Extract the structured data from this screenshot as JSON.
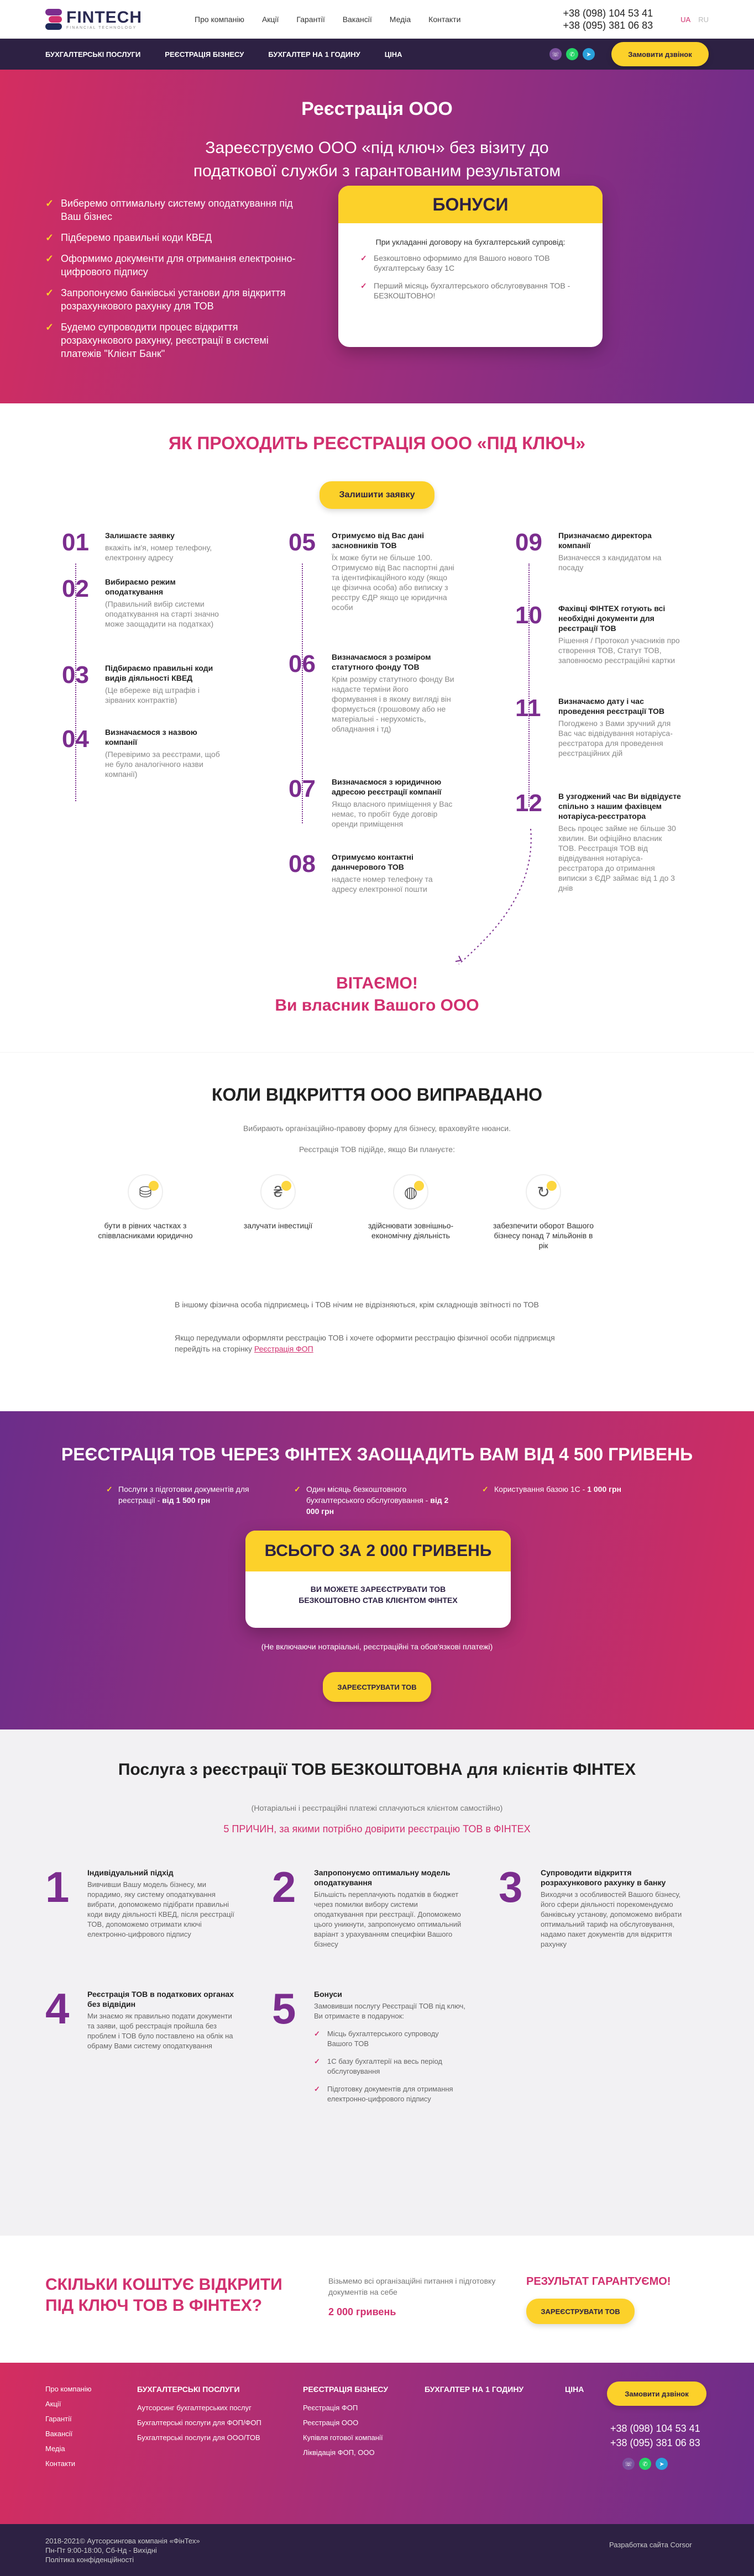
{
  "header": {
    "logo_name": "FINTECH",
    "logo_sub": "FINANCIAL TECHNOLOGY",
    "nav": [
      "Про компанію",
      "Акції",
      "Гарантії",
      "Вакансії",
      "Медіа",
      "Контакти"
    ],
    "phones": [
      "+38 (098) 104 53 41",
      "+38 (095) 381 06 83"
    ],
    "langs": [
      "UA",
      "RU"
    ]
  },
  "servicenav": {
    "items": [
      "Бухгалтерські послуги",
      "Реєстрація бізнесу",
      "Бухгалтер на 1 годину",
      "Ціна"
    ],
    "order_button": "Замовити дзвінок"
  },
  "hero": {
    "title": "Реєстрація ООО",
    "subtitle": "Зареєструємо ООО «під ключ» без візиту до податкової служби з гарантованим результатом",
    "checks": [
      "Виберемо оптимальну систему оподаткування під Ваш бізнес",
      "Підберемо правильні коди КВЕД",
      "Оформимо документи для отримання електронно-цифрового підпису",
      "Запропонуємо банківські установи для відкриття розрахункового рахунку для ТОВ",
      "Будемо супроводити процес відкриття розрахункового рахунку, реєстрації в системі платежів \"Клієнт Банк\""
    ],
    "bonus_title": "БОНУСИ",
    "bonus_intro": "При укладанні договору на бухгалтерський супровід:",
    "bonus_items": [
      "Безкоштовно оформимо для Вашого нового ТОВ бухгалтерську базу 1С",
      "Перший місяць бухгалтерського обслуговування ТОВ - БЕЗКОШТОВНО!"
    ]
  },
  "steps": {
    "title": "ЯК ПРОХОДИТЬ РЕЄСТРАЦІЯ ООО «ПІД КЛЮЧ»",
    "button": "Залишити заявку",
    "items": [
      {
        "num": "01",
        "title": "Залишаєте заявку",
        "text": "вкажіть ім'я, номер телефону, електронну адресу"
      },
      {
        "num": "02",
        "title": "Вибираємо режим оподаткування",
        "text": "(Правильний вибір системи оподаткування на старті значно може заощадити на податках)"
      },
      {
        "num": "03",
        "title": "Підбираємо правильні коди видів діяльності КВЕД",
        "text": "(Це вбереже від штрафів і зірваних контрактів)"
      },
      {
        "num": "04",
        "title": "Визначаємося з назвою компанії",
        "text": "(Перевіримо за реєстрами, щоб не було аналогічного назви компанії)"
      },
      {
        "num": "05",
        "title": "Отримуємо від Вас дані засновників ТОВ",
        "text": "Їх може бути не більше 100. Отримуємо від Вас паспортні дані та ідентифікаційного коду (якщо це фізична особа) або виписку з реєстру ЄДР якщо це юридична особи"
      },
      {
        "num": "06",
        "title": "Визначаємося з розміром статутного фонду ТОВ",
        "text": "Крім розміру статутного фонду Ви надаєте терміни його формування і в якому вигляді він формується (грошовому або не матеріальні - нерухомість, обладнання і тд)"
      },
      {
        "num": "07",
        "title": "Визначаємося з юридичною адресою реєстрації компанії",
        "text": "Якщо власного приміщення у Вас немає, то пробіт буде договір оренди приміщення"
      },
      {
        "num": "08",
        "title": "Отримуємо контактні даннчерового ТОВ",
        "text": "надаєте номер телефону та адресу електронної пошти"
      },
      {
        "num": "09",
        "title": "Призначаємо директора компанії",
        "text": "Визначеєся з кандидатом на посаду"
      },
      {
        "num": "10",
        "title": "Фахівці ФІНТЕХ готують всі необхідні документи для реєстрації ТОВ",
        "text": "Рішення / Протокол учасників про створення ТОВ, Статут ТОВ, заповнюємо реєстраційні картки"
      },
      {
        "num": "11",
        "title": "Визначаємо дату і час проведення реєстрації ТОВ",
        "text": "Погоджено з Вами зручний для Вас час відвідування нотаріуса-реєстратора для проведення реєстраційних дій"
      },
      {
        "num": "12",
        "title": "В узгоджений час Ви відвідуєте спільно з нашим фахівцем нотаріуса-реєстратора",
        "text": "Весь процес займе не більше 30 хвилин. Ви офіційно власник ТОВ. Реєстрація ТОВ від відвідування нотаріуса-реєстратора до отримання виписки з ЄДР займає від 1 до 3 днів"
      }
    ],
    "congrats_1": "ВІТАЄМО!",
    "congrats_2": "Ви власник Вашого ООО"
  },
  "when": {
    "title": "КОЛИ ВІДКРИТТЯ ООО ВИПРАВДАНО",
    "lead": "Вибирають організаційно-правову форму для бізнесу, враховуйте нюанси.",
    "lead2": "Реєстрація ТОВ підійде, якщо Ви плануєте:",
    "icons": [
      {
        "icon": "coins-icon",
        "label": "бути в рівних частках з співвласниками юридично"
      },
      {
        "icon": "investment-icon",
        "label": "залучати інвестиції"
      },
      {
        "icon": "globe-icon",
        "label": "здійснювати зовнішньо-економічну діяльність"
      },
      {
        "icon": "turnover-icon",
        "label": "забезпечити оборот Вашого бізнесу понад 7 мільйонів в рік"
      }
    ],
    "note1": "В іншому фізична особа підприємець і ТОВ нічим не відрізняються, крім складнощів звітності по ТОВ",
    "note2": "Якщо передумали оформляти реєстрацію ТОВ і хочете оформити реєстрацію фізичної особи підприємця перейдіть на сторінку",
    "note2_link": "Реєстрація ФОП"
  },
  "save": {
    "title": "РЕЄСТРАЦІЯ ТОВ ЧЕРЕЗ ФІНТЕХ ЗАОЩАДИТЬ ВАМ ВІД 4 500 ГРИВЕНЬ",
    "items": [
      {
        "text": "Послуги з підготовки документів для реєстрації - ",
        "value": "від 1 500 грн"
      },
      {
        "text": "Один місяць безкоштовного бухгалтерського обслуговування - ",
        "value": "від 2 000 грн"
      },
      {
        "text": "Користування базою 1С - ",
        "value": "1 000 грн"
      }
    ],
    "total_title": "ВСЬОГО ЗА 2 000 ГРИВЕНЬ",
    "total_text": "ВИ МОЖЕТЕ ЗАРЕЄСТРУВАТИ ТОВ БЕЗКОШТОВНО СТАВ КЛІЄНТОМ ФІНТЕХ",
    "paren": "(Не включаючи нотаріальні, реєстраційні та обов'язкові платежі)",
    "button": "ЗАРЕЄСТРУВАТИ ТОВ"
  },
  "free": {
    "title": "Послуга з реєстрації ТОВ БЕЗКОШТОВНА для клієнтів ФІНТЕХ",
    "sub": "(Нотаріальні і реєстраційні платежі сплачуються клієнтом самостійно)",
    "why": "5 ПРИЧИН, за якими потрібно довірити реєстрацію ТОВ в ФІНТЕХ",
    "reasons": [
      {
        "n": "1",
        "title": "Індивідуальний підхід",
        "text": "Вивчивши Вашу модель бізнесу, ми порадимо, яку систему оподаткування вибрати, допоможемо підібрати правильні коди виду діяльності КВЕД, після реєстрації ТОВ, допоможемо отримати ключі електронно-цифрового підпису"
      },
      {
        "n": "2",
        "title": "Запропонуємо оптимальну модель оподаткування",
        "text": "Більшість переплачують податків в бюджет через помилки вибору системи оподаткування при реєстрації. Допоможемо цього уникнути, запропонуємо оптимальний варіант з урахуванням специфіки Вашого бізнесу"
      },
      {
        "n": "3",
        "title": "Супроводити відкриття розрахункового рахунку в банку",
        "text": "Виходячи з особливостей Вашого бізнесу, його сфери діяльності порекомендуємо банківську установу, допоможемо вибрати оптимальний тариф на обслуговування, надамо пакет документів для відкриття рахунку"
      },
      {
        "n": "4",
        "title": "Реєстрація ТОВ в податкових органах без відвідин",
        "text": "Ми знаємо як правильно подати документи та заяви, щоб реєстрація пройшла без проблем і ТОВ було поставлено на облік на обраму Вами систему оподаткування"
      },
      {
        "n": "5",
        "title": "Бонуси",
        "text": "Замовивши послугу Реєстрації ТОВ під ключ, Ви отримаєте в подарунок:",
        "list": [
          "Місць бухгалтерського супроводу Вашого ТОВ",
          "1С базу бухгалтерії на весь період обслуговування",
          "Підготовку документів для отримання електронно-цифрового підпису"
        ]
      }
    ]
  },
  "cost": {
    "title": "СКІЛЬКИ КОШТУЄ ВІДКРИТИ ПІД КЛЮЧ ТОВ В ФІНТЕХ?",
    "text": "Візьмемо всі організаційні питання і підготовку документів на себе",
    "price": "2 000 гривень",
    "result": "РЕЗУЛЬТАТ ГАРАНТУЄМО!",
    "button": "ЗАРЕЄСТРУВАТИ ТОВ"
  },
  "footer": {
    "col1": [
      "Про компанію",
      "Акції",
      "Гарантії",
      "Вакансії",
      "Медіа",
      "Контакти"
    ],
    "col2_title": "БУХГАЛТЕРСЬКІ ПОСЛУГИ",
    "col2": [
      "Аутсорсинг бухгалтерських послуг",
      "Бухгалтерські послуги для ФОП/ФОП",
      "Бухгалтерські послуги для ООО/ТОВ"
    ],
    "col3_title": "РЕЄСТРАЦІЯ БІЗНЕСУ",
    "col3": [
      "Реєстрація ФОП",
      "Реєстрація ООО",
      "Купівля готової компанії",
      "Ліквідація ФОП, ООО"
    ],
    "col4_title": "БУХГАЛТЕР НА 1 ГОДИНУ",
    "col5_title": "ЦІНА",
    "button": "Замовити дзвінок",
    "phones": [
      "+38 (098) 104 53 41",
      "+38 (095) 381 06 83"
    ],
    "copyright": "2018-2021© Аутсорсингова компанія «ФінТех»",
    "hours": "Пн-Пт 9:00-18:00, Сб-Нд - Вихідні",
    "privacy": "Політика конфіденційності",
    "dev": "Разработка сайта Corsor"
  },
  "colors": {
    "accent": "#d1306f",
    "purple": "#7b2d8e",
    "yellow": "#fcd12a",
    "dark": "#2d2143"
  }
}
